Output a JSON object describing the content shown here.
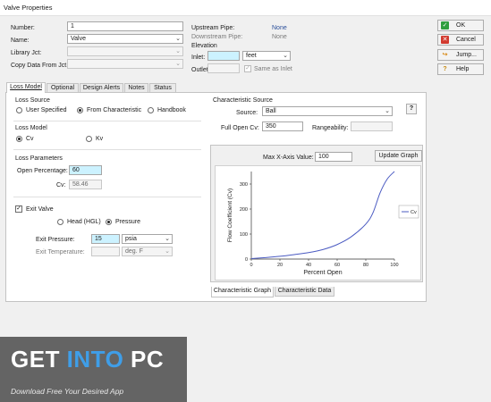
{
  "window": {
    "title": "Valve Properties"
  },
  "general": {
    "number_label": "Number:",
    "number_value": "1",
    "name_label": "Name:",
    "name_value": "Valve",
    "library_label": "Library Jct:",
    "library_value": "",
    "copy_label": "Copy Data From Jct...",
    "copy_value": ""
  },
  "pipes": {
    "upstream_label": "Upstream Pipe:",
    "upstream_value": "None",
    "downstream_label": "Downstream Pipe:",
    "downstream_value": "None"
  },
  "elevation": {
    "title": "Elevation",
    "inlet_label": "Inlet:",
    "inlet_value": "",
    "inlet_unit": "feet",
    "outlet_label": "Outlet:",
    "same_as_inlet": "Same as Inlet"
  },
  "buttons": {
    "ok": "OK",
    "cancel": "Cancel",
    "jump": "Jump...",
    "help": "Help"
  },
  "tabs": [
    "Loss Model",
    "Optional",
    "Design Alerts",
    "Notes",
    "Status"
  ],
  "loss_source": {
    "title": "Loss Source",
    "options": [
      "User Specified",
      "From Characteristic",
      "Handbook"
    ],
    "selected": "From Characteristic"
  },
  "loss_model": {
    "title": "Loss Model",
    "options": [
      "Cv",
      "Kv"
    ],
    "selected": "Cv"
  },
  "loss_params": {
    "title": "Loss Parameters",
    "open_pct_label": "Open Percentage:",
    "open_pct_value": "60",
    "cv_label": "Cv:",
    "cv_value": "58.46"
  },
  "exit_valve": {
    "label": "Exit Valve",
    "checked": true,
    "options": [
      "Head (HGL)",
      "Pressure"
    ],
    "selected": "Pressure",
    "pressure_label": "Exit Pressure:",
    "pressure_value": "15",
    "pressure_unit": "psia",
    "temp_label": "Exit Temperature:",
    "temp_value": "",
    "temp_unit": "deg. F"
  },
  "char_source": {
    "title": "Characteristic Source",
    "source_label": "Source:",
    "source_value": "Ball",
    "help_label": "?",
    "full_open_label": "Full Open Cv:",
    "full_open_value": "350",
    "rangeability_label": "Rangeability:",
    "rangeability_value": ""
  },
  "graph": {
    "max_x_label": "Max X-Axis Value:",
    "max_x_value": "100",
    "update_label": "Update Graph"
  },
  "chart_data": {
    "type": "line",
    "title": "",
    "xlabel": "Percent Open",
    "ylabel": "Flow Coefficient (Cv)",
    "xlim": [
      0,
      100
    ],
    "ylim": [
      0,
      350
    ],
    "xticks": [
      0,
      20,
      40,
      60,
      80,
      100
    ],
    "yticks": [
      0,
      100,
      200,
      300
    ],
    "grid": false,
    "legend": "right",
    "color": "#4b5bc2",
    "series": [
      {
        "name": "Cv",
        "x": [
          0,
          10,
          20,
          30,
          40,
          50,
          60,
          70,
          80,
          85,
          90,
          95,
          100
        ],
        "y": [
          2,
          6,
          11,
          18,
          26,
          38,
          58,
          90,
          140,
          185,
          265,
          320,
          350
        ]
      }
    ]
  },
  "graph_tabs": [
    "Characteristic Graph",
    "Characteristic Data"
  ],
  "watermark": {
    "title_a": "GET ",
    "title_b": "INTO",
    "title_c": " PC",
    "subtitle": "Download Free Your Desired App"
  }
}
